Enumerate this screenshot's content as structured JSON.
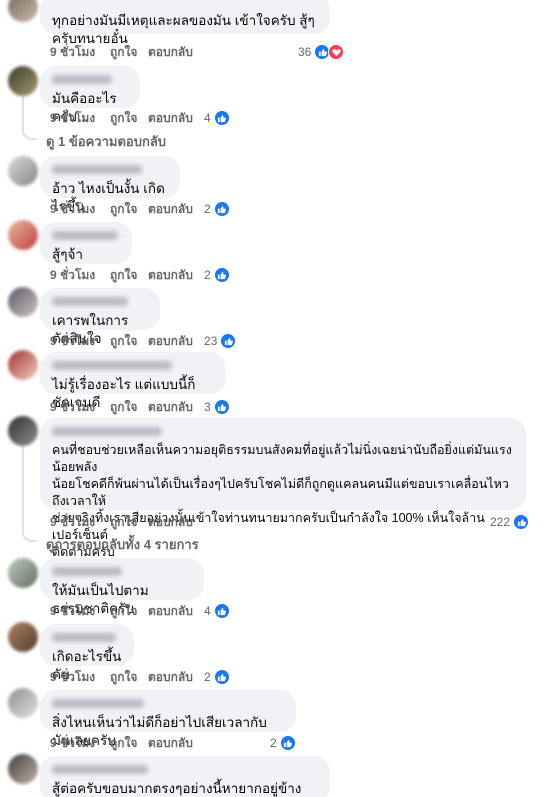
{
  "colors": {
    "like": "#1877f2",
    "love": "#f33e58",
    "bubble": "#f0f2f5",
    "meta": "#65676b"
  },
  "comments": [
    {
      "text": "ทุกอย่างมันมีเหตุและผลของมัน เข้าใจครับ สู้ๆครับทนายอั๋น",
      "time": "9 ชั่วโมง",
      "like": "ถูกใจ",
      "reply": "ตอบกลับ",
      "count": "36",
      "icons": [
        "like-icon",
        "heart-icon"
      ]
    },
    {
      "text": "มันคืออะไร ครับ. .",
      "time": "9 ชั่วโมง",
      "like": "ถูกใจ",
      "reply": "ตอบกลับ",
      "count": "4",
      "icons": [
        "like-icon"
      ]
    },
    {
      "text": "อ้าว ไหงเป็นงั้น เกิดไรขึ้น",
      "time": "9 ชั่วโมง",
      "like": "ถูกใจ",
      "reply": "ตอบกลับ",
      "count": "2",
      "icons": [
        "like-icon"
      ]
    },
    {
      "text": "สู้ๆจ้า",
      "time": "9 ชั่วโมง",
      "like": "ถูกใจ",
      "reply": "ตอบกลับ",
      "count": "2",
      "icons": [
        "like-icon"
      ]
    },
    {
      "text": "เคารพในการตัดสินใจ",
      "time": "9 ชั่วโมง",
      "like": "ถูกใจ",
      "reply": "ตอบกลับ",
      "count": "23",
      "icons": [
        "like-icon"
      ]
    },
    {
      "text": "ไม่รู้เรื่องอะไร แต่แบบนี้ก็ชัดเจนดี",
      "time": "9 ชั่วโมง",
      "like": "ถูกใจ",
      "reply": "ตอบกลับ",
      "count": "3",
      "icons": [
        "like-icon"
      ]
    },
    {
      "text": "คนที่ชอบช่วยเหลือเห็นความอยุติธรรมบนสังคมที่อยู่แล้วไม่นิ่งเฉยน่านับถือยิ่งแต่มันแรงน้อยพลัง\nน้อยโชคดีก็พ้นผ่านได้เป็นเรื่องๆไปครับโชคไม่ดีก็ถูกดูแคลนคนมีแต่ขอบเราเคลื่อนไหวถึงเวลาให้\nช่วยจริงทิ้งเราเสียอย่างนั้นเข้าใจท่านทนายมากครับเป็นกำลังใจ 100% เห็นใจล้านเปอร์เซ็นต์\nติดตามครับ",
      "time": "9 ชั่วโมง",
      "like": "ถูกใจ",
      "reply": "ตอบกลับ",
      "count": "222",
      "icons": [
        "like-icon"
      ]
    },
    {
      "text": "ให้มันเป็นไปตามธรรมชาติครับ",
      "time": "9 ชั่วโมง",
      "like": "ถูกใจ",
      "reply": "ตอบกลับ",
      "count": "4",
      "icons": [
        "like-icon"
      ]
    },
    {
      "text": "เกิดอะไรขึ้นคับ",
      "time": "9 ชั่วโมง",
      "like": "ถูกใจ",
      "reply": "ตอบกลับ",
      "count": "2",
      "icons": [
        "like-icon"
      ]
    },
    {
      "text": "สิ่งไหนเห็นว่าไม่ดีก็อย่าไปเสียเวลากับมันเลยครับ",
      "time": "9 ชั่วโมง",
      "like": "ถูกใจ",
      "reply": "ตอบกลับ",
      "count": "2",
      "icons": [
        "like-icon"
      ]
    },
    {
      "text": "สู้ต่อครับขอบมากตรงๆอย่างนี้หายากอยู่ข้างทนายอั๋นครับ"
    }
  ],
  "reply_links": {
    "view_one": "ดู 1 ข้อความตอบกลับ",
    "view_all": "ดูการตอบกลับทั้ง 4 รายการ"
  }
}
